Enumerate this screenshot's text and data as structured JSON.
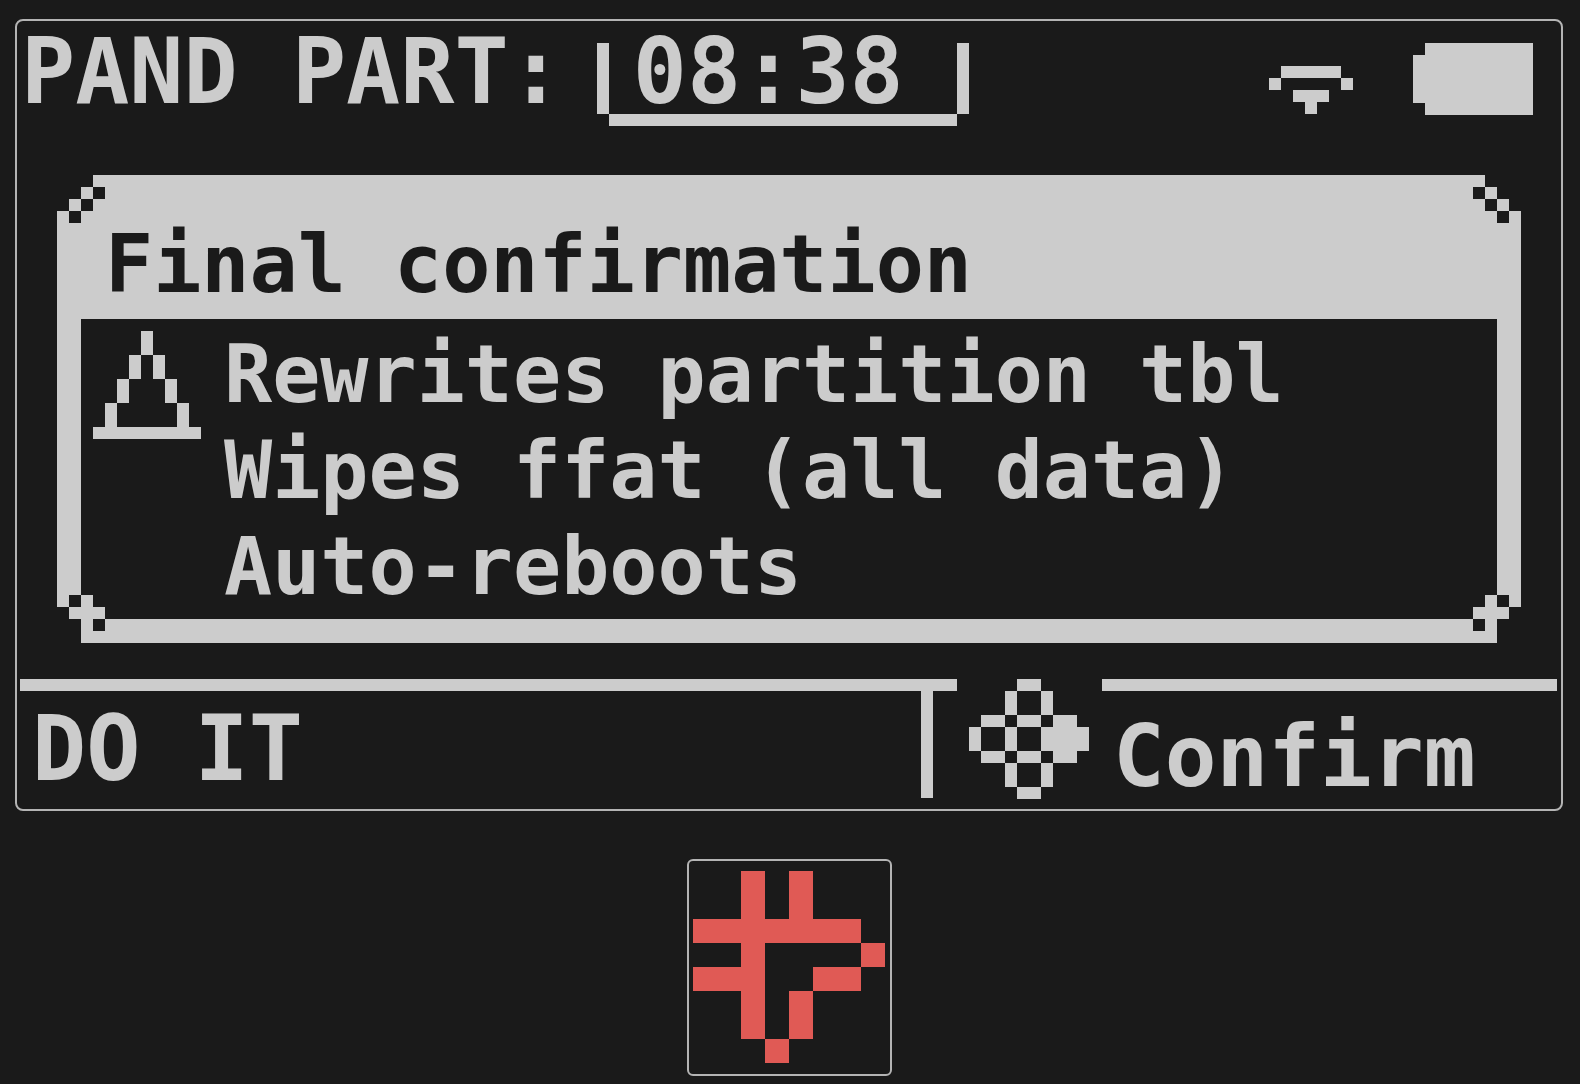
{
  "status_bar": {
    "title": "PAND PART:",
    "time": "08:38"
  },
  "dialog": {
    "title": "Final confirmation",
    "lines": [
      "Rewrites partition tbl",
      "Wipes ffat (all data)",
      "Auto-reboots"
    ]
  },
  "softkeys": [
    {
      "label": "DO IT",
      "kind": "plain"
    },
    {
      "label": "Confirm",
      "kind": "dpad"
    }
  ]
}
